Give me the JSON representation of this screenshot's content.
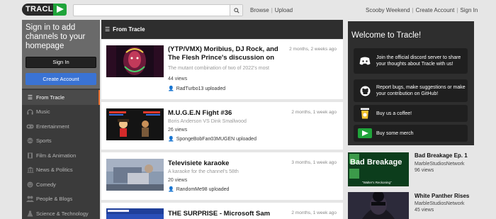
{
  "header": {
    "logo_text": "TRACLE",
    "search_placeholder": "",
    "browse": "Browse",
    "upload": "Upload",
    "user_name": "Scooby Weekend",
    "create_account": "Create Account",
    "sign_in": "Sign In"
  },
  "sidebar": {
    "signin_title": "Sign in to add channels to your homepage",
    "signin_button": "Sign In",
    "create_button": "Create Account",
    "items": [
      {
        "label": "From Tracle",
        "icon": "list-icon"
      },
      {
        "label": "Music",
        "icon": "headphones-icon"
      },
      {
        "label": "Entertainment",
        "icon": "gamepad-icon"
      },
      {
        "label": "Sports",
        "icon": "ball-icon"
      },
      {
        "label": "Film & Animation",
        "icon": "film-icon"
      },
      {
        "label": "News & Politics",
        "icon": "bank-icon"
      },
      {
        "label": "Comedy",
        "icon": "smile-icon"
      },
      {
        "label": "People & Blogs",
        "icon": "people-icon"
      },
      {
        "label": "Science & Technology",
        "icon": "flask-icon"
      }
    ]
  },
  "main": {
    "heading": "From Tracle",
    "videos": [
      {
        "title": "(YTP/VMX) Moribius, DJ Rock, and The Flesh Prince's discussion on",
        "date": "2 months, 2 weeks ago",
        "desc": "The mutant combination of two of 2022's most",
        "views": "44 views",
        "user": "RadTurbo13 uploaded"
      },
      {
        "title": "M.U.G.E.N Fight #36",
        "date": "2 months, 1 week ago",
        "desc": "Boris Anderson VS Dink Smallwood",
        "views": "26 views",
        "user": "SpongeBobFan03MUGEN uploaded"
      },
      {
        "title": "Televisiete karaoke",
        "date": "3 months, 1 week ago",
        "desc": "A karaoke for the channel's 58th",
        "views": "20 views",
        "user": "RandomMe98 uploaded"
      },
      {
        "title": "THE SURPRISE - Microsoft Sam",
        "date": "2 months, 1 week ago",
        "desc": "",
        "views": "",
        "user": ""
      }
    ]
  },
  "welcome": {
    "title": "Welcome to Tracle!",
    "buttons": [
      {
        "text": "Join the official discord server to share your thoughts about Tracle with us!",
        "icon": "discord-icon"
      },
      {
        "text": "Report bugs, make suggestions or make your contribution on GitHub!",
        "icon": "github-icon"
      },
      {
        "text": "Buy us a coffee!",
        "icon": "coffee-icon"
      },
      {
        "text": "Buy some merch",
        "icon": "tracle-merch-icon"
      }
    ]
  },
  "side_videos": [
    {
      "title": "Bad Breakage Ep. 1",
      "channel": "MarbleStudiosNetwork",
      "views": "96 views",
      "thumb_text": "Bad Breakage",
      "thumb_sub": "\"Walter's Reckoning\""
    },
    {
      "title": "White Panther Rises",
      "channel": "MarbleStudiosNetwork",
      "views": "45 views"
    }
  ],
  "colors": {
    "accent_orange": "#e86a28",
    "brand_green": "#1fa43a",
    "create_blue": "#3a73d4",
    "dark_panel": "#2e2e2e"
  }
}
